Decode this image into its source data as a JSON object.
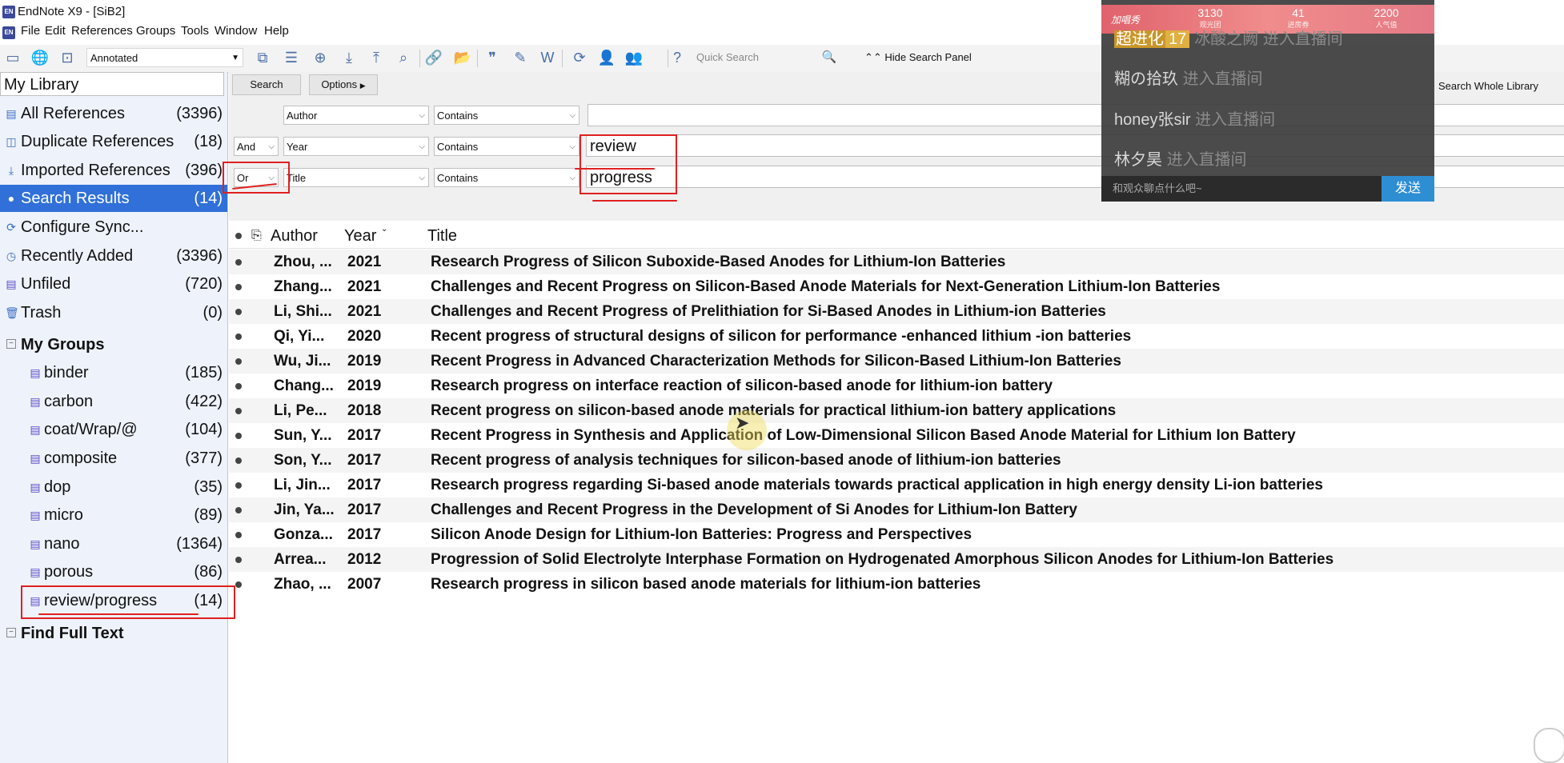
{
  "window": {
    "title": "EndNote X9 - [SiB2]",
    "icon_text": "EN"
  },
  "menu": [
    "File",
    "Edit",
    "References",
    "Groups",
    "Tools",
    "Window",
    "Help"
  ],
  "toolbar": {
    "style": "Annotated",
    "quick_search_placeholder": "Quick Search",
    "hide_search_label": "Hide Search Panel",
    "help_label": "?"
  },
  "sidebar": {
    "library_title": "My Library",
    "items": [
      {
        "label": "All References",
        "count": "(3396)",
        "icon": "all-references-icon"
      },
      {
        "label": "Duplicate References",
        "count": "(18)",
        "icon": "duplicate-references-icon"
      },
      {
        "label": "Imported References",
        "count": "(396)",
        "icon": "imported-references-icon"
      },
      {
        "label": "Search Results",
        "count": "(14)",
        "icon": "search-results-icon"
      },
      {
        "label": "Configure Sync...",
        "count": "",
        "icon": "sync-icon"
      },
      {
        "label": "Recently Added",
        "count": "(3396)",
        "icon": "recently-added-icon"
      },
      {
        "label": "Unfiled",
        "count": "(720)",
        "icon": "unfiled-icon"
      },
      {
        "label": "Trash",
        "count": "(0)",
        "icon": "trash-icon"
      }
    ],
    "groups_title": "My Groups",
    "groups": [
      {
        "label": "binder",
        "count": "(185)"
      },
      {
        "label": "carbon",
        "count": "(422)"
      },
      {
        "label": "coat/Wrap/@",
        "count": "(104)"
      },
      {
        "label": "composite",
        "count": "(377)"
      },
      {
        "label": "dop",
        "count": "(35)"
      },
      {
        "label": "micro",
        "count": "(89)"
      },
      {
        "label": "nano",
        "count": "(1364)"
      },
      {
        "label": "porous",
        "count": "(86)"
      },
      {
        "label": "review/progress",
        "count": "(14)"
      }
    ],
    "find_full_text": "Find Full Text"
  },
  "search": {
    "search_button": "Search",
    "options_button": "Options",
    "scope": "Search Whole Library",
    "rows": [
      {
        "bool": "",
        "field": "Author",
        "op": "Contains",
        "value": ""
      },
      {
        "bool": "And",
        "field": "Year",
        "op": "Contains",
        "value": "review"
      },
      {
        "bool": "Or",
        "field": "Title",
        "op": "Contains",
        "value": "progress"
      }
    ]
  },
  "results": {
    "headers": {
      "author": "Author",
      "year": "Year",
      "title": "Title"
    },
    "rows": [
      {
        "author": "Zhou, ...",
        "year": "2021",
        "title": "Research Progress of Silicon Suboxide-Based Anodes for Lithium-Ion Batteries"
      },
      {
        "author": "Zhang...",
        "year": "2021",
        "title": "Challenges and Recent Progress on Silicon-Based Anode Materials for Next-Generation Lithium-Ion Batteries"
      },
      {
        "author": "Li, Shi...",
        "year": "2021",
        "title": "Challenges and Recent Progress of Prelithiation for Si-Based Anodes in Lithium-ion Batteries"
      },
      {
        "author": "Qi, Yi...",
        "year": "2020",
        "title": "Recent progress of structural designs of silicon for performance -enhanced lithium -ion batteries"
      },
      {
        "author": "Wu, Ji...",
        "year": "2019",
        "title": "Recent Progress in Advanced Characterization Methods for Silicon-Based Lithium-Ion Batteries"
      },
      {
        "author": "Chang...",
        "year": "2019",
        "title": "Research progress on interface reaction of silicon-based anode for lithium-ion battery"
      },
      {
        "author": "Li, Pe...",
        "year": "2018",
        "title": "Recent progress on silicon-based anode materials for practical lithium-ion battery applications"
      },
      {
        "author": "Sun, Y...",
        "year": "2017",
        "title": "Recent Progress in Synthesis and Application of Low-Dimensional Silicon Based Anode Material for Lithium Ion Battery"
      },
      {
        "author": "Son, Y...",
        "year": "2017",
        "title": "Recent progress of analysis techniques for silicon-based anode of lithium-ion batteries"
      },
      {
        "author": "Li, Jin...",
        "year": "2017",
        "title": "Research progress regarding Si-based anode materials towards practical application in high energy density Li-ion batteries"
      },
      {
        "author": "Jin, Ya...",
        "year": "2017",
        "title": "Challenges and Recent Progress in the Development of Si Anodes for Lithium-Ion Battery"
      },
      {
        "author": "Gonza...",
        "year": "2017",
        "title": "Silicon Anode Design for Lithium-Ion Batteries: Progress and Perspectives"
      },
      {
        "author": "Arrea...",
        "year": "2012",
        "title": "Progression of Solid Electrolyte Interphase Formation on Hydrogenated Amorphous Silicon Anodes for Lithium-Ion Batteries"
      },
      {
        "author": "Zhao, ...",
        "year": "2007",
        "title": "Research progress in silicon based anode materials for lithium-ion batteries"
      }
    ]
  },
  "overlay": {
    "badge": "加唱秀",
    "stats": [
      {
        "value": "3130",
        "label": "观光团"
      },
      {
        "value": "41",
        "label": "进房券"
      },
      {
        "value": "2200",
        "label": "人气值"
      }
    ],
    "lines": [
      {
        "user": "超进化",
        "level": "17",
        "name": "冰酸之阙",
        "action": "进入直播间"
      },
      {
        "user": "糊の拾玖",
        "action": "进入直播间"
      },
      {
        "user": "honey张sir",
        "action": "进入直播间"
      },
      {
        "user": "林夕昊",
        "action": "进入直播间"
      }
    ],
    "input_placeholder": "和观众聊点什么吧~",
    "send": "发送"
  },
  "colors": {
    "selection": "#3070d8",
    "annotation_red": "#e02020",
    "sidebar_bg": "#eef2fa",
    "send_blue": "#2d8ed4"
  }
}
